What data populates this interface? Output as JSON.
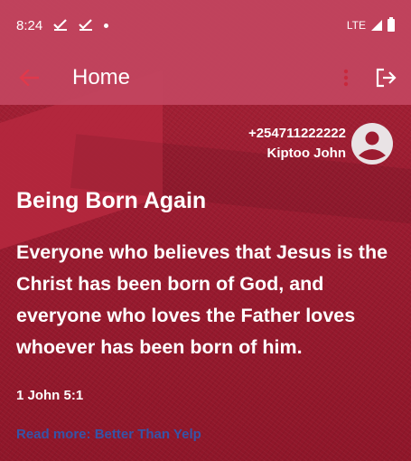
{
  "status_bar": {
    "time": "8:24",
    "network": "LTE"
  },
  "app_bar": {
    "title": "Home"
  },
  "user": {
    "phone": "+254711222222",
    "name": "Kiptoo John"
  },
  "verse": {
    "title": "Being Born Again",
    "text": "Everyone who believes that Jesus is the Christ has been born of God, and everyone who loves the Father loves whoever has been born of him.",
    "reference": "1 John 5:1"
  },
  "read_more": {
    "label": "Read more: Better Than Yelp"
  },
  "colors": {
    "bar": "#c24560",
    "background": "#9c1c30",
    "back_arrow": "#e0394c",
    "menu_dots": "#c8283c",
    "link": "#3554a8"
  }
}
